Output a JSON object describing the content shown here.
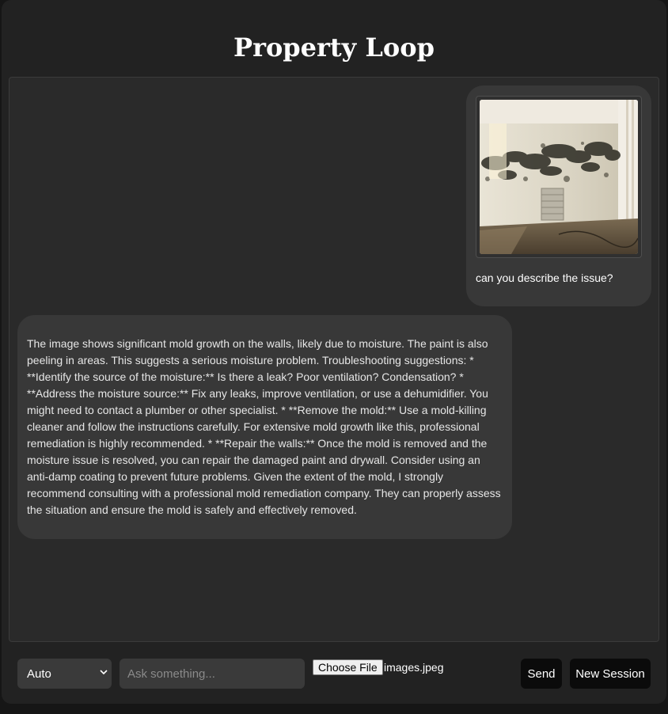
{
  "app": {
    "title": "Property Loop"
  },
  "chat": {
    "user_message": {
      "text": "can you describe the issue?",
      "attachment_icon": "uploaded-photo-mold-wall"
    },
    "bot_message": {
      "text": "The image shows significant mold growth on the walls, likely due to moisture. The paint is also peeling in areas. This suggests a serious moisture problem. Troubleshooting suggestions: * **Identify the source of the moisture:** Is there a leak? Poor ventilation? Condensation? * **Address the moisture source:** Fix any leaks, improve ventilation, or use a dehumidifier. You might need to contact a plumber or other specialist. * **Remove the mold:** Use a mold-killing cleaner and follow the instructions carefully. For extensive mold growth like this, professional remediation is highly recommended. * **Repair the walls:** Once the mold is removed and the moisture issue is resolved, you can repair the damaged paint and drywall. Consider using an anti-damp coating to prevent future problems. Given the extent of the mold, I strongly recommend consulting with a professional mold remediation company. They can properly assess the situation and ensure the mold is safely and effectively removed."
    }
  },
  "controls": {
    "mode_select": {
      "selected": "Auto",
      "options": [
        "Auto"
      ]
    },
    "ask_input": {
      "value": "",
      "placeholder": "Ask something..."
    },
    "file_input": {
      "button_label": "Choose File",
      "file_name": "images.jpeg"
    },
    "send_label": "Send",
    "new_session_label": "New Session"
  },
  "colors": {
    "page_background": "#161616",
    "app_background": "#222222",
    "chat_background": "#2a2a2a",
    "bubble_background": "#383838",
    "input_background": "#3a3a3a",
    "button_background": "#0b0b0b",
    "text_primary": "#ffffff"
  }
}
